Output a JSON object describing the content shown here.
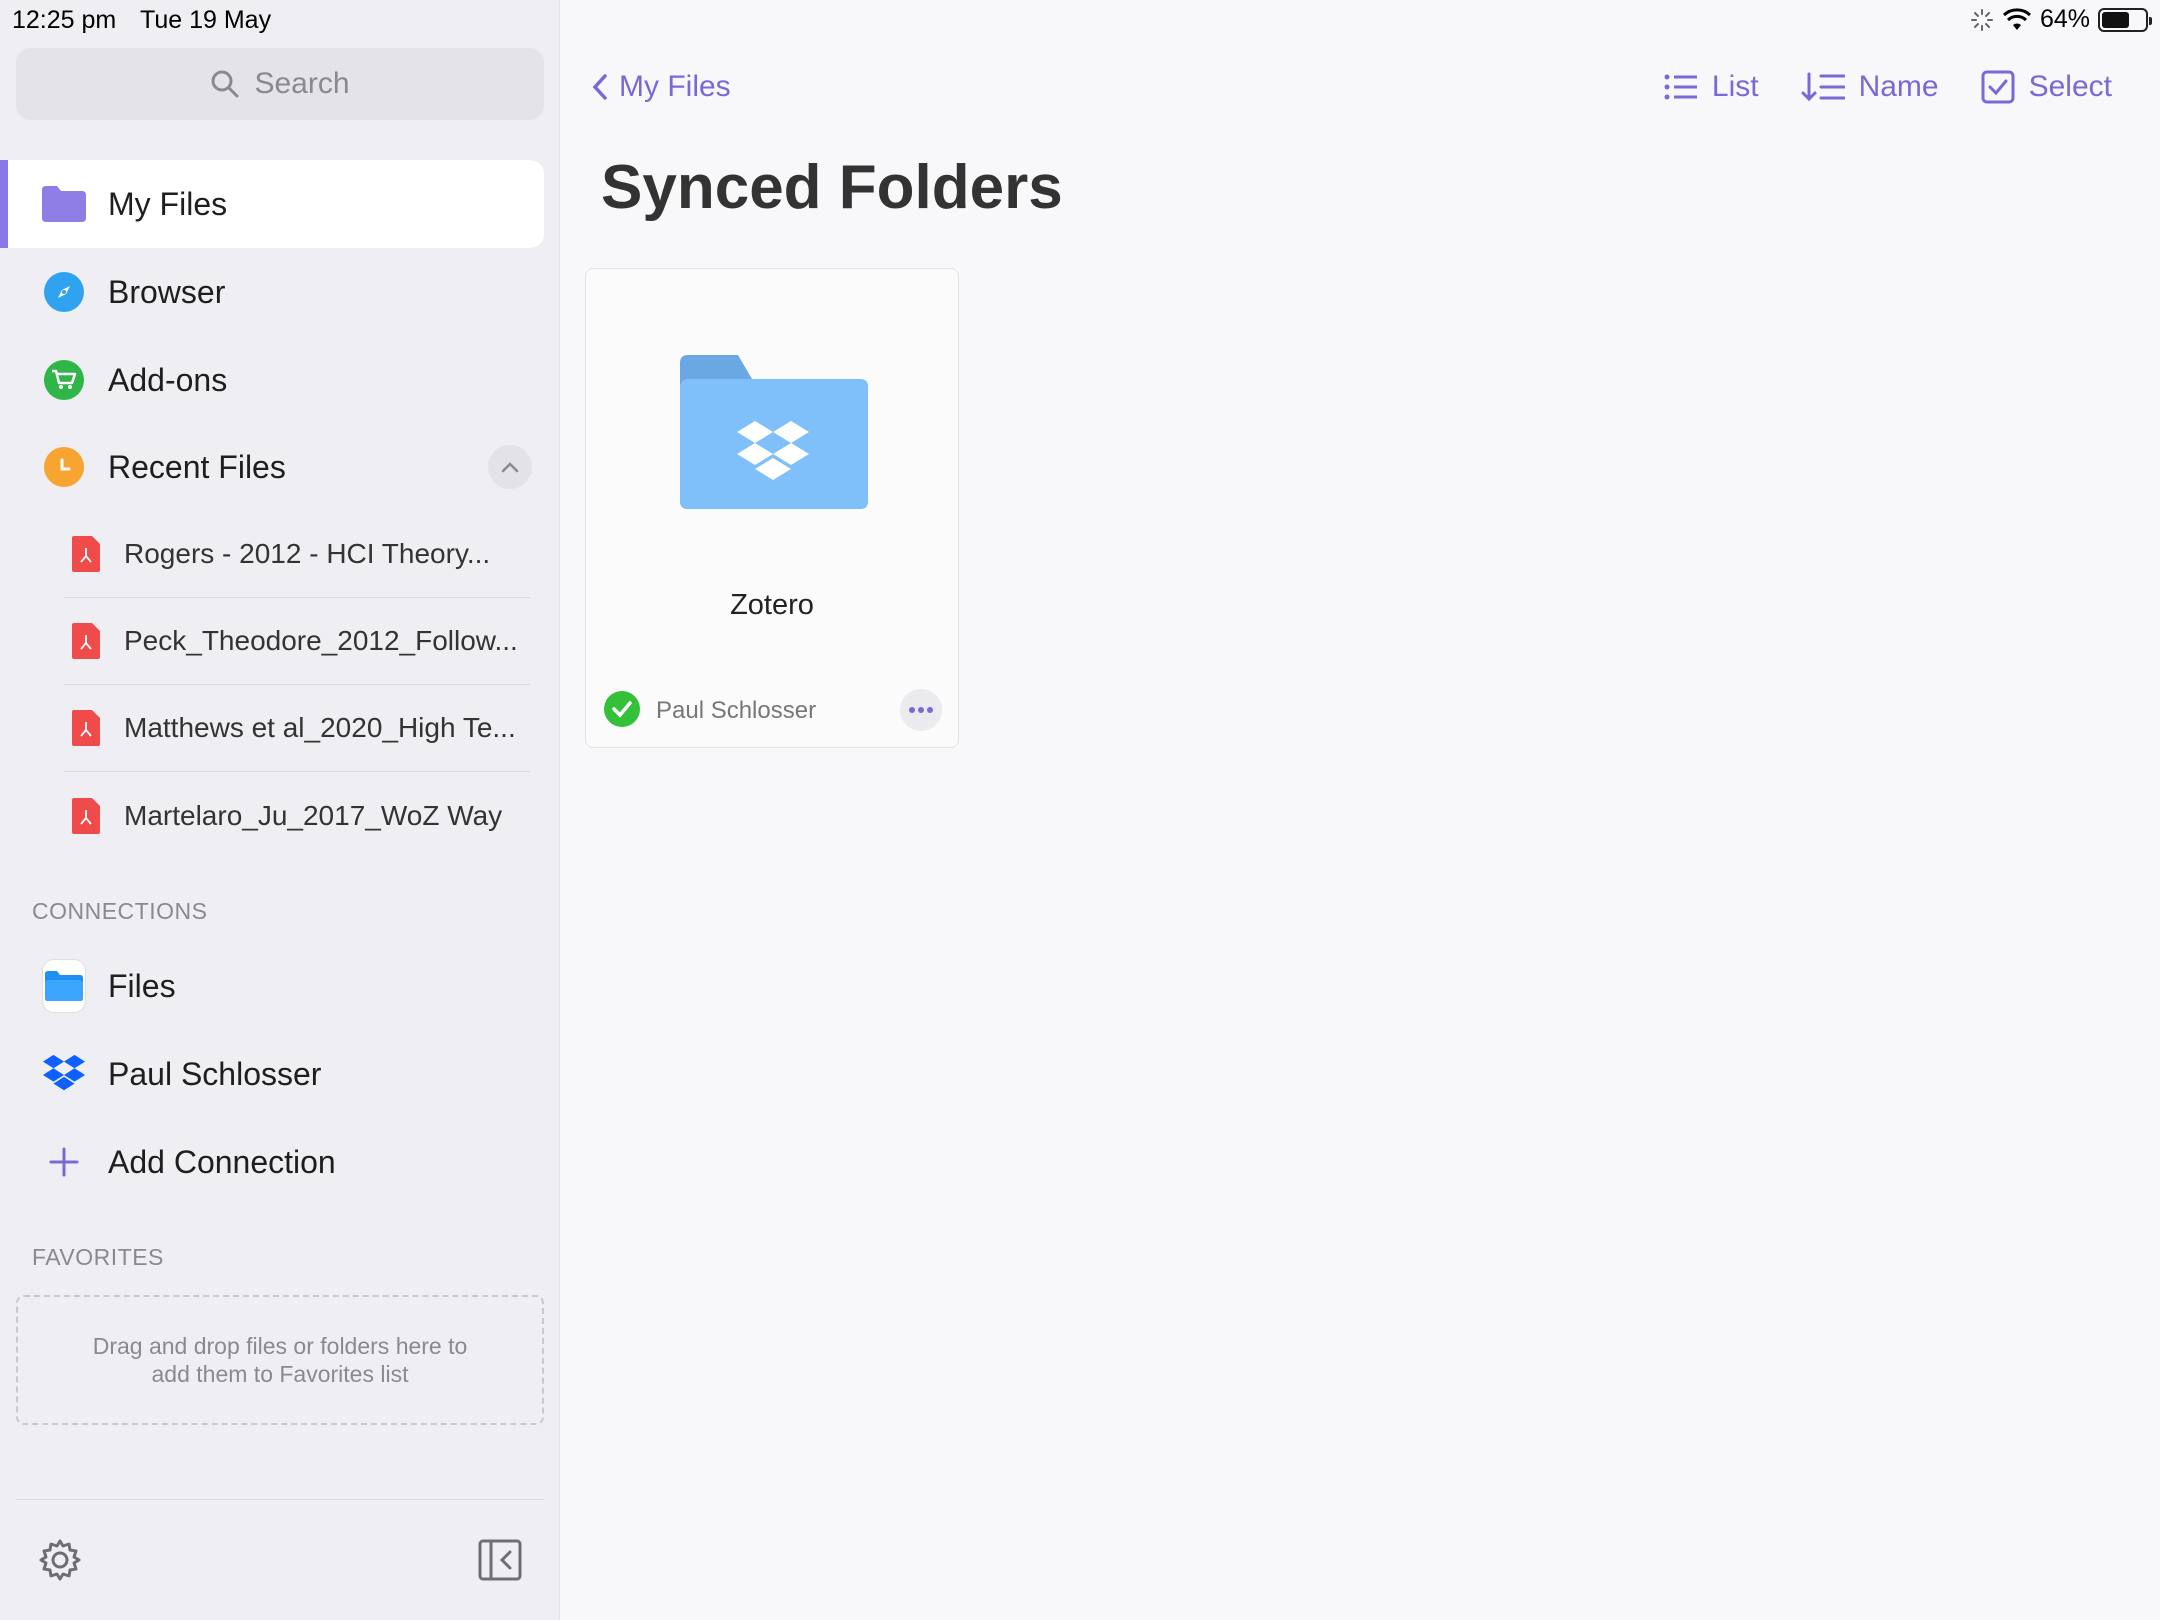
{
  "status_bar": {
    "time": "12:25 pm",
    "date": "Tue 19 May",
    "battery": "64%",
    "battery_level": 0.64
  },
  "sidebar": {
    "search_placeholder": "Search",
    "nav": [
      {
        "label": "My Files",
        "icon": "folder-icon",
        "selected": true
      },
      {
        "label": "Browser",
        "icon": "compass-icon"
      },
      {
        "label": "Add-ons",
        "icon": "cart-icon"
      },
      {
        "label": "Recent Files",
        "icon": "clock-icon",
        "expanded": true
      }
    ],
    "recent_files": [
      "Rogers - 2012 - HCI Theory...",
      "Peck_Theodore_2012_Follow...",
      "Matthews et al_2020_High Te...",
      "Martelaro_Ju_2017_WoZ Way"
    ],
    "connections_header": "CONNECTIONS",
    "connections": [
      {
        "label": "Files",
        "icon": "files-app-icon"
      },
      {
        "label": "Paul Schlosser",
        "icon": "dropbox-icon"
      },
      {
        "label": "Add Connection",
        "icon": "plus-icon"
      }
    ],
    "favorites_header": "FAVORITES",
    "favorites_hint": "Drag and drop files or folders here to add them to Favorites list"
  },
  "main": {
    "back_label": "My Files",
    "toolbar": {
      "list_label": "List",
      "sort_label": "Name",
      "select_label": "Select"
    },
    "title": "Synced Folders",
    "folders": [
      {
        "name": "Zotero",
        "owner": "Paul Schlosser",
        "synced": true
      }
    ]
  },
  "colors": {
    "accent": "#7b68d6",
    "selected_bar": "#8a78e8",
    "folder": "#7fbffa",
    "folder_tab": "#6aa8e4",
    "browser": "#2fa3f0",
    "addons": "#2fb548",
    "recent": "#f7a530",
    "pdf": "#ef4b4b",
    "dropbox": "#0d60ff",
    "synced": "#33c13a"
  }
}
